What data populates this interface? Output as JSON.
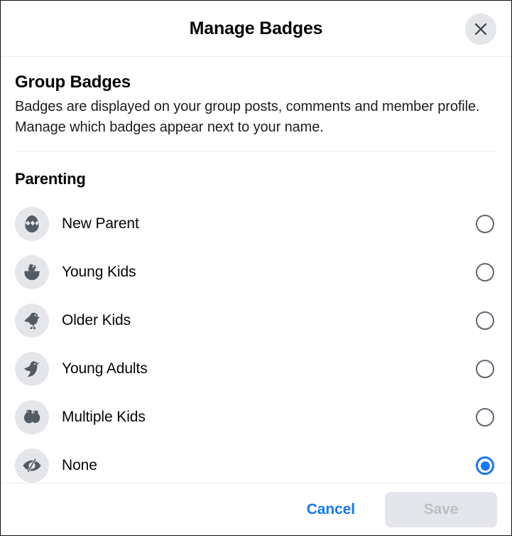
{
  "header": {
    "title": "Manage Badges",
    "close_icon": "close-icon"
  },
  "intro": {
    "heading": "Group Badges",
    "description": "Badges are displayed on your group posts, comments and member profile. Manage which badges appear next to your name."
  },
  "group": {
    "title": "Parenting"
  },
  "badges": [
    {
      "label": "New Parent",
      "icon": "cracked-egg-icon",
      "selected": false
    },
    {
      "label": "Young Kids",
      "icon": "chick-in-nest-icon",
      "selected": false
    },
    {
      "label": "Older Kids",
      "icon": "standing-bird-icon",
      "selected": false
    },
    {
      "label": "Young Adults",
      "icon": "flying-bird-icon",
      "selected": false
    },
    {
      "label": "Multiple Kids",
      "icon": "two-birds-icon",
      "selected": false
    },
    {
      "label": "None",
      "icon": "eye-slash-icon",
      "selected": true
    }
  ],
  "footer": {
    "cancel_label": "Cancel",
    "save_label": "Save",
    "save_disabled": true
  },
  "colors": {
    "accent": "#1877f2",
    "icon_bg": "#e4e6eb",
    "icon_fg": "#545b64",
    "text": "#050505",
    "radio_border": "#606770",
    "disabled_text": "#bcc0c4"
  }
}
